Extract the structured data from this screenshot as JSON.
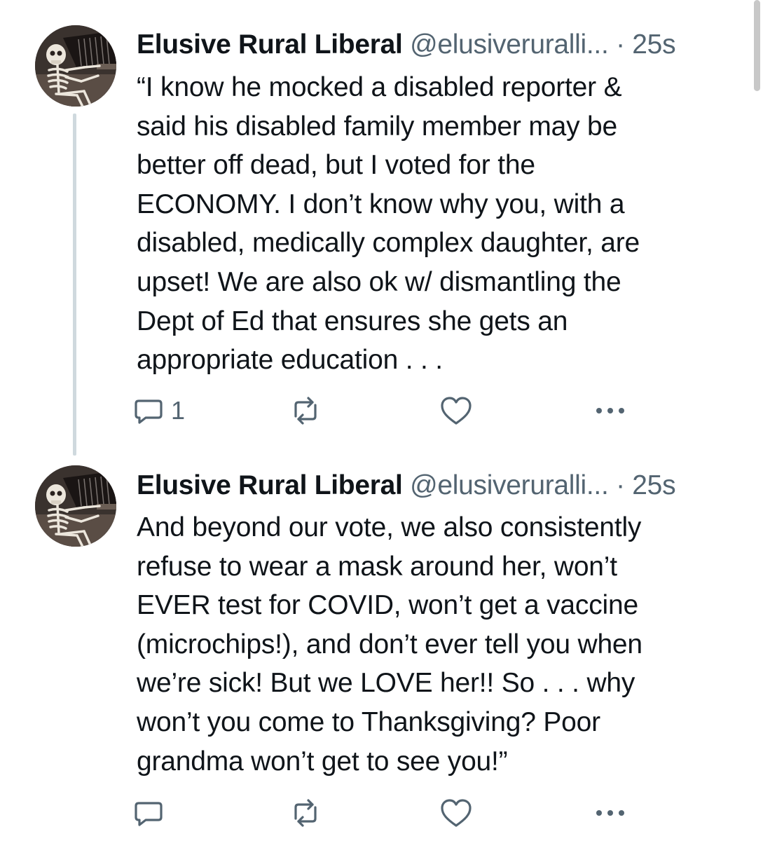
{
  "posts": [
    {
      "author_name": "Elusive Rural Liberal",
      "handle": "@elusiveruralli...",
      "time": "· 25s",
      "text": "“I know he mocked a disabled reporter &\nsaid his disabled family member may be\nbetter off dead, but I voted for the\nECONOMY. I don’t know why you, with a\ndisabled, medically complex daughter, are\nupset! We are also ok w/ dismantling the\nDept of Ed that ensures she gets an\nappropriate education . . .",
      "actions": {
        "reply_icon": "comment-icon",
        "reply_count": "1",
        "repost_icon": "repost-icon",
        "like_icon": "heart-icon",
        "more_icon": "more-icon"
      }
    },
    {
      "author_name": "Elusive Rural Liberal",
      "handle": "@elusiveruralli...",
      "time": "· 25s",
      "text": "And beyond our vote, we also consistently\nrefuse to wear a mask around her, won’t\nEVER test for COVID, won’t get a vaccine\n(microchips!), and don’t ever tell you when\nwe’re sick! But we LOVE her!! So . . . why\nwon’t you come to Thanksgiving? Poor\ngrandma won’t get to see you!”",
      "actions": {
        "reply_icon": "comment-icon",
        "repost_icon": "repost-icon",
        "like_icon": "heart-icon",
        "more_icon": "more-icon"
      }
    }
  ],
  "colors": {
    "text": "#0f1419",
    "secondary": "#536471",
    "thread_line": "#cfd9de"
  }
}
